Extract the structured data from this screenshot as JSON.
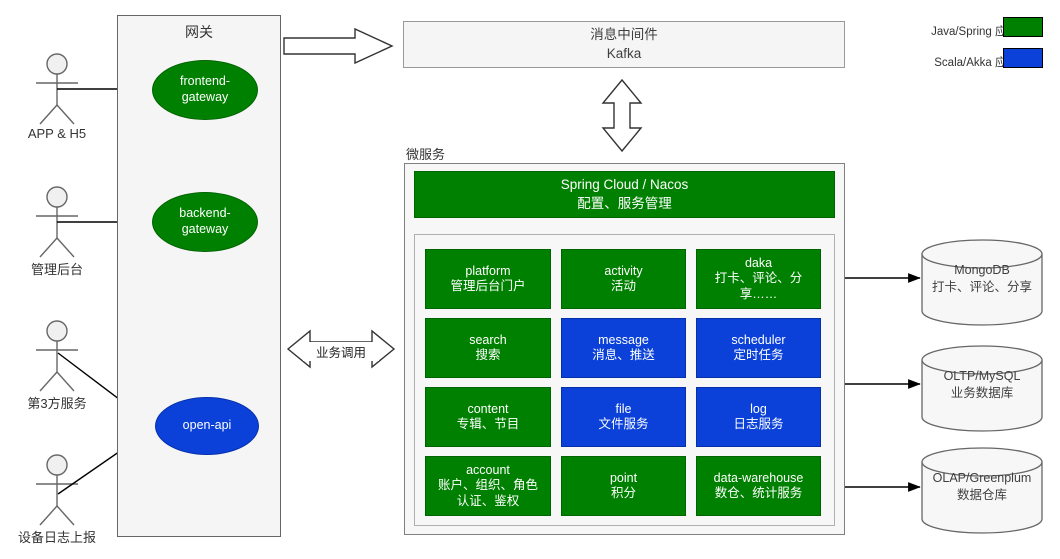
{
  "legend": {
    "items": [
      {
        "label": "Java/Spring 应用",
        "color": "#008000",
        "icon": "legend-swatch-green"
      },
      {
        "label": "Scala/Akka 应用",
        "color": "#0b41d8",
        "icon": "legend-swatch-blue"
      }
    ]
  },
  "actors": [
    {
      "label": "APP & H5"
    },
    {
      "label": "管理后台"
    },
    {
      "label": "第3方服务"
    },
    {
      "label": "设备日志上报"
    }
  ],
  "gateway": {
    "title": "网关",
    "nodes": [
      {
        "name": "frontend-gateway",
        "line1": "frontend-",
        "line2": "gateway",
        "color": "#008000"
      },
      {
        "name": "backend-gateway",
        "line1": "backend-",
        "line2": "gateway",
        "color": "#008000"
      },
      {
        "name": "open-api",
        "line1": "open-api",
        "line2": "",
        "color": "#0b41d8"
      }
    ]
  },
  "kafka": {
    "line1": "消息中间件",
    "line2": "Kafka"
  },
  "connections": {
    "business_call_label": "业务调用"
  },
  "microservices": {
    "title": "微服务",
    "banner": {
      "line1": "Spring Cloud / Nacos",
      "line2": "配置、服务管理"
    },
    "grid": [
      [
        {
          "name": "platform",
          "line1": "platform",
          "line2": "管理后台门户",
          "line3": "",
          "color": "#008000"
        },
        {
          "name": "activity",
          "line1": "activity",
          "line2": "活动",
          "line3": "",
          "color": "#008000"
        },
        {
          "name": "daka",
          "line1": "daka",
          "line2": "打卡、评论、分",
          "line3": "享……",
          "color": "#008000"
        }
      ],
      [
        {
          "name": "search",
          "line1": "search",
          "line2": "搜索",
          "line3": "",
          "color": "#008000"
        },
        {
          "name": "message",
          "line1": "message",
          "line2": "消息、推送",
          "line3": "",
          "color": "#0b41d8"
        },
        {
          "name": "scheduler",
          "line1": "scheduler",
          "line2": "定时任务",
          "line3": "",
          "color": "#0b41d8"
        }
      ],
      [
        {
          "name": "content",
          "line1": "content",
          "line2": "专辑、节目",
          "line3": "",
          "color": "#008000"
        },
        {
          "name": "file",
          "line1": "file",
          "line2": "文件服务",
          "line3": "",
          "color": "#0b41d8"
        },
        {
          "name": "log",
          "line1": "log",
          "line2": "日志服务",
          "line3": "",
          "color": "#0b41d8"
        }
      ],
      [
        {
          "name": "account",
          "line1": "account",
          "line2": "账户、组织、角色",
          "line3": "认证、鉴权",
          "color": "#008000"
        },
        {
          "name": "point",
          "line1": "point",
          "line2": "积分",
          "line3": "",
          "color": "#008000"
        },
        {
          "name": "data-warehouse",
          "line1": "data-warehouse",
          "line2": "数仓、统计服务",
          "line3": "",
          "color": "#008000"
        }
      ]
    ]
  },
  "datastores": [
    {
      "name": "mongodb",
      "line1": "MongoDB",
      "line2": "打卡、评论、分享"
    },
    {
      "name": "mysql",
      "line1": "OLTP/MySQL",
      "line2": "业务数据库"
    },
    {
      "name": "greenplum",
      "line1": "OLAP/Greenplum",
      "line2": "数据仓库"
    }
  ]
}
